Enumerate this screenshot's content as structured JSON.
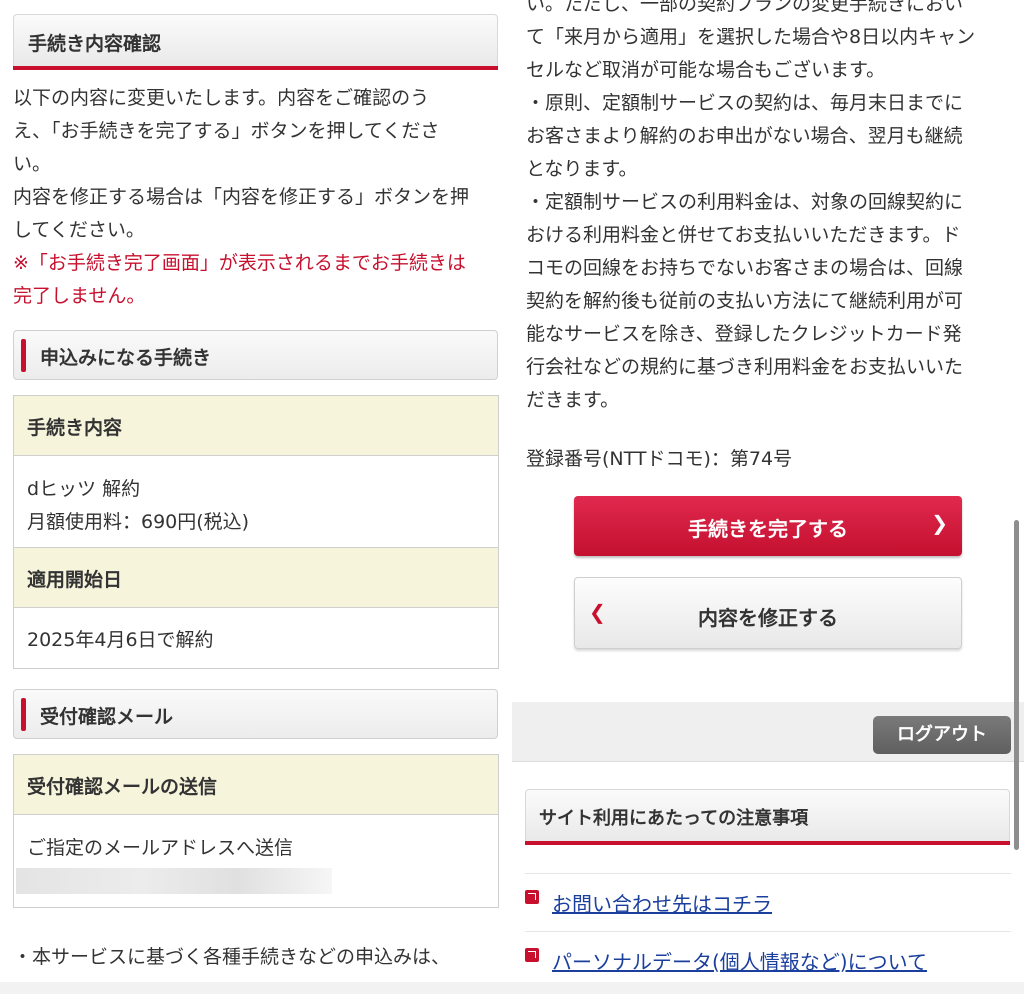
{
  "left": {
    "section_title": "手続き内容確認",
    "intro_lines": [
      "以下の内容に変更いたします。内容をご確認のう",
      "え、「お手続きを完了する」ボタンを押してくださ",
      "い。",
      "内容を修正する場合は「内容を修正する」ボタンを押",
      "してください。"
    ],
    "warning_lines": [
      "※「お手続き完了画面」が表示されるまでお手続きは",
      "完了しません。"
    ],
    "procedure_header": "申込みになる手続き",
    "procedure_table": {
      "content_label": "手続き内容",
      "content_value_1": "dヒッツ 解約",
      "content_value_2": "月額使用料：690円(税込)",
      "start_label": "適用開始日",
      "start_value": "2025年4月6日で解約"
    },
    "mail_header": "受付確認メール",
    "mail_table": {
      "label": "受付確認メールの送信",
      "value": "ご指定のメールアドレスへ送信"
    },
    "notice_line": "・本サービスに基づく各種手続きなどの申込みは、"
  },
  "right": {
    "notice_lines": [
      "い。ただし、一部の契約プランの変更手続きにおい",
      "て「来月から適用」を選択した場合や8日以内キャン",
      "セルなど取消が可能な場合もございます。",
      "・原則、定額制サービスの契約は、毎月末日までに",
      "お客さまより解約のお申出がない場合、翌月も継続",
      "となります。",
      "・定額制サービスの利用料金は、対象の回線契約に",
      "おける利用料金と併せてお支払いいただきます。ド",
      "コモの回線をお持ちでないお客さまの場合は、回線",
      "契約を解約後も従前の支払い方法にて継続利用が可",
      "能なサービスを除き、登録したクレジットカード発",
      "行会社などの規約に基づき利用料金をお支払いいた",
      "だきます。"
    ],
    "registration": "登録番号(NTTドコモ)：第74号",
    "complete_button": "手続きを完了する",
    "modify_button": "内容を修正する",
    "logout_button": "ログアウト",
    "site_notes_title": "サイト利用にあたっての注意事項",
    "links": [
      "お問い合わせ先はコチラ",
      "パーソナルデータ(個人情報など)について"
    ]
  },
  "colors": {
    "accent_red": "#c8102e",
    "table_header_bg": "#f7f4dc",
    "link_blue": "#1a3f9e"
  }
}
